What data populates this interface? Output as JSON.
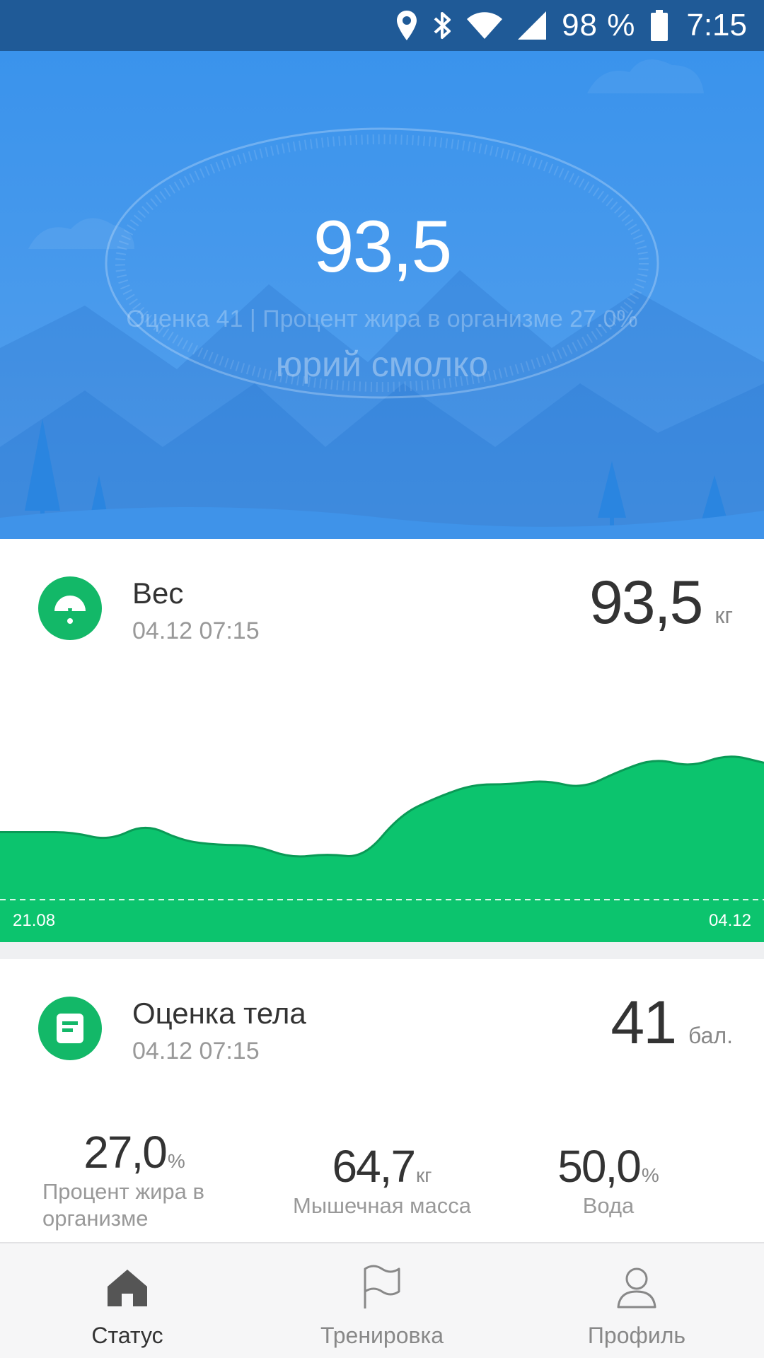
{
  "status_bar": {
    "battery": "98 %",
    "time": "7:15",
    "icons": [
      "location-icon",
      "bluetooth-icon",
      "wifi-icon",
      "signal-icon",
      "battery-icon"
    ]
  },
  "hero": {
    "weight": "93,5",
    "subtitle": "Оценка 41  |  Процент жира в организме 27.0%",
    "user_name": "юрий смолко"
  },
  "weight_card": {
    "icon": "scale-gauge-icon",
    "title": "Вес",
    "date": "04.12 07:15",
    "value": "93,5",
    "unit": "кг"
  },
  "chart_data": {
    "type": "area",
    "x_start_label": "21.08",
    "x_end_label": "04.12",
    "color": "#0cc46e",
    "values": [
      92.2,
      92.2,
      92.2,
      92.0,
      92.4,
      92.0,
      91.9,
      91.9,
      91.6,
      91.7,
      91.6,
      92.6,
      93.0,
      93.3,
      93.3,
      93.4,
      93.2,
      93.6,
      93.9,
      93.7,
      94.0,
      93.8
    ]
  },
  "body_card": {
    "icon": "note-icon",
    "title": "Оценка тела",
    "date": "04.12 07:15",
    "value": "41",
    "unit": "бал."
  },
  "metrics": [
    {
      "value": "27,0",
      "unit": "%",
      "label_line1": "Процент жира в",
      "label_line2": "организме"
    },
    {
      "value": "64,7",
      "unit": "кг",
      "label_line1": "Мышечная масса",
      "label_line2": ""
    },
    {
      "value": "50,0",
      "unit": "%",
      "label_line1": "Вода",
      "label_line2": ""
    }
  ],
  "nav": [
    {
      "label": "Статус",
      "icon": "home-icon",
      "active": true
    },
    {
      "label": "Тренировка",
      "icon": "flag-icon",
      "active": false
    },
    {
      "label": "Профиль",
      "icon": "person-icon",
      "active": false
    }
  ],
  "colors": {
    "status_bar": "#1f5a97",
    "hero_blue": "#3a93ec",
    "accent_green": "#13b868"
  }
}
